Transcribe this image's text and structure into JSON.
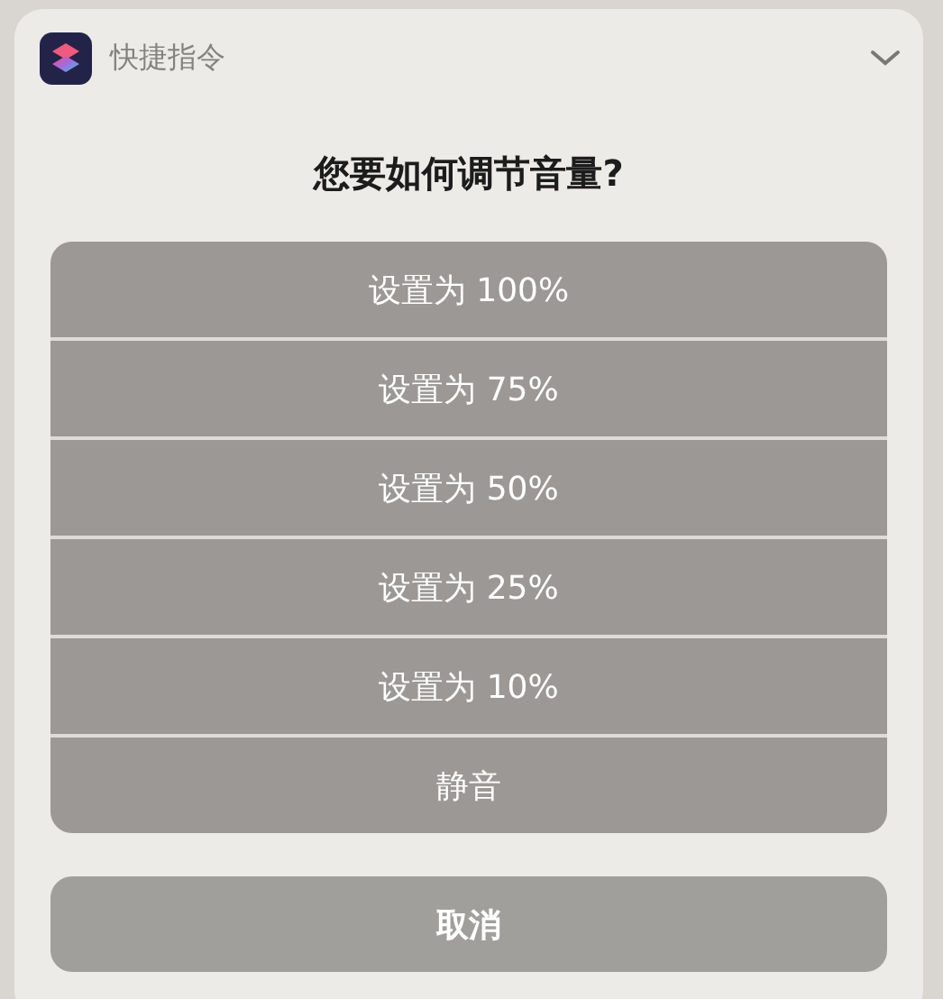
{
  "app": {
    "name": "快捷指令"
  },
  "prompt": "您要如何调节音量?",
  "options": [
    "设置为 100%",
    "设置为 75%",
    "设置为 50%",
    "设置为 25%",
    "设置为 10%",
    "静音"
  ],
  "cancel_button": "取消"
}
